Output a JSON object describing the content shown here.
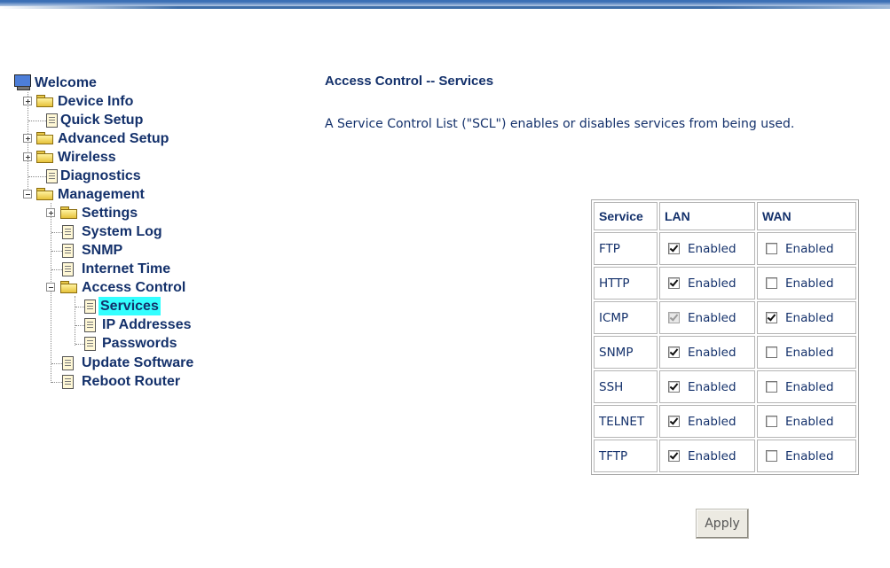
{
  "nav": {
    "welcome": "Welcome",
    "device_info": "Device Info",
    "quick_setup": "Quick Setup",
    "advanced_setup": "Advanced Setup",
    "wireless": "Wireless",
    "diagnostics": "Diagnostics",
    "management": "Management",
    "settings": "Settings",
    "system_log": "System Log",
    "snmp": "SNMP",
    "internet_time": "Internet Time",
    "access_control": "Access Control",
    "services": "Services",
    "ip_addresses": "IP Addresses",
    "passwords": "Passwords",
    "update_software": "Update Software",
    "reboot_router": "Reboot Router"
  },
  "page": {
    "title": "Access Control -- Services",
    "description": "A Service Control List (\"SCL\") enables or disables services from being used."
  },
  "table": {
    "headers": {
      "service": "Service",
      "lan": "LAN",
      "wan": "WAN"
    },
    "enabled_label": "Enabled",
    "rows": [
      {
        "service": "FTP",
        "lan": true,
        "lan_disabled": false,
        "wan": false
      },
      {
        "service": "HTTP",
        "lan": true,
        "lan_disabled": false,
        "wan": false
      },
      {
        "service": "ICMP",
        "lan": true,
        "lan_disabled": true,
        "wan": true
      },
      {
        "service": "SNMP",
        "lan": true,
        "lan_disabled": false,
        "wan": false
      },
      {
        "service": "SSH",
        "lan": true,
        "lan_disabled": false,
        "wan": false
      },
      {
        "service": "TELNET",
        "lan": true,
        "lan_disabled": false,
        "wan": false
      },
      {
        "service": "TFTP",
        "lan": true,
        "lan_disabled": false,
        "wan": false
      }
    ]
  },
  "buttons": {
    "apply": "Apply"
  },
  "colors": {
    "text": "#14316b",
    "selection": "#33ffff",
    "topbar": "#3e6ea8"
  }
}
